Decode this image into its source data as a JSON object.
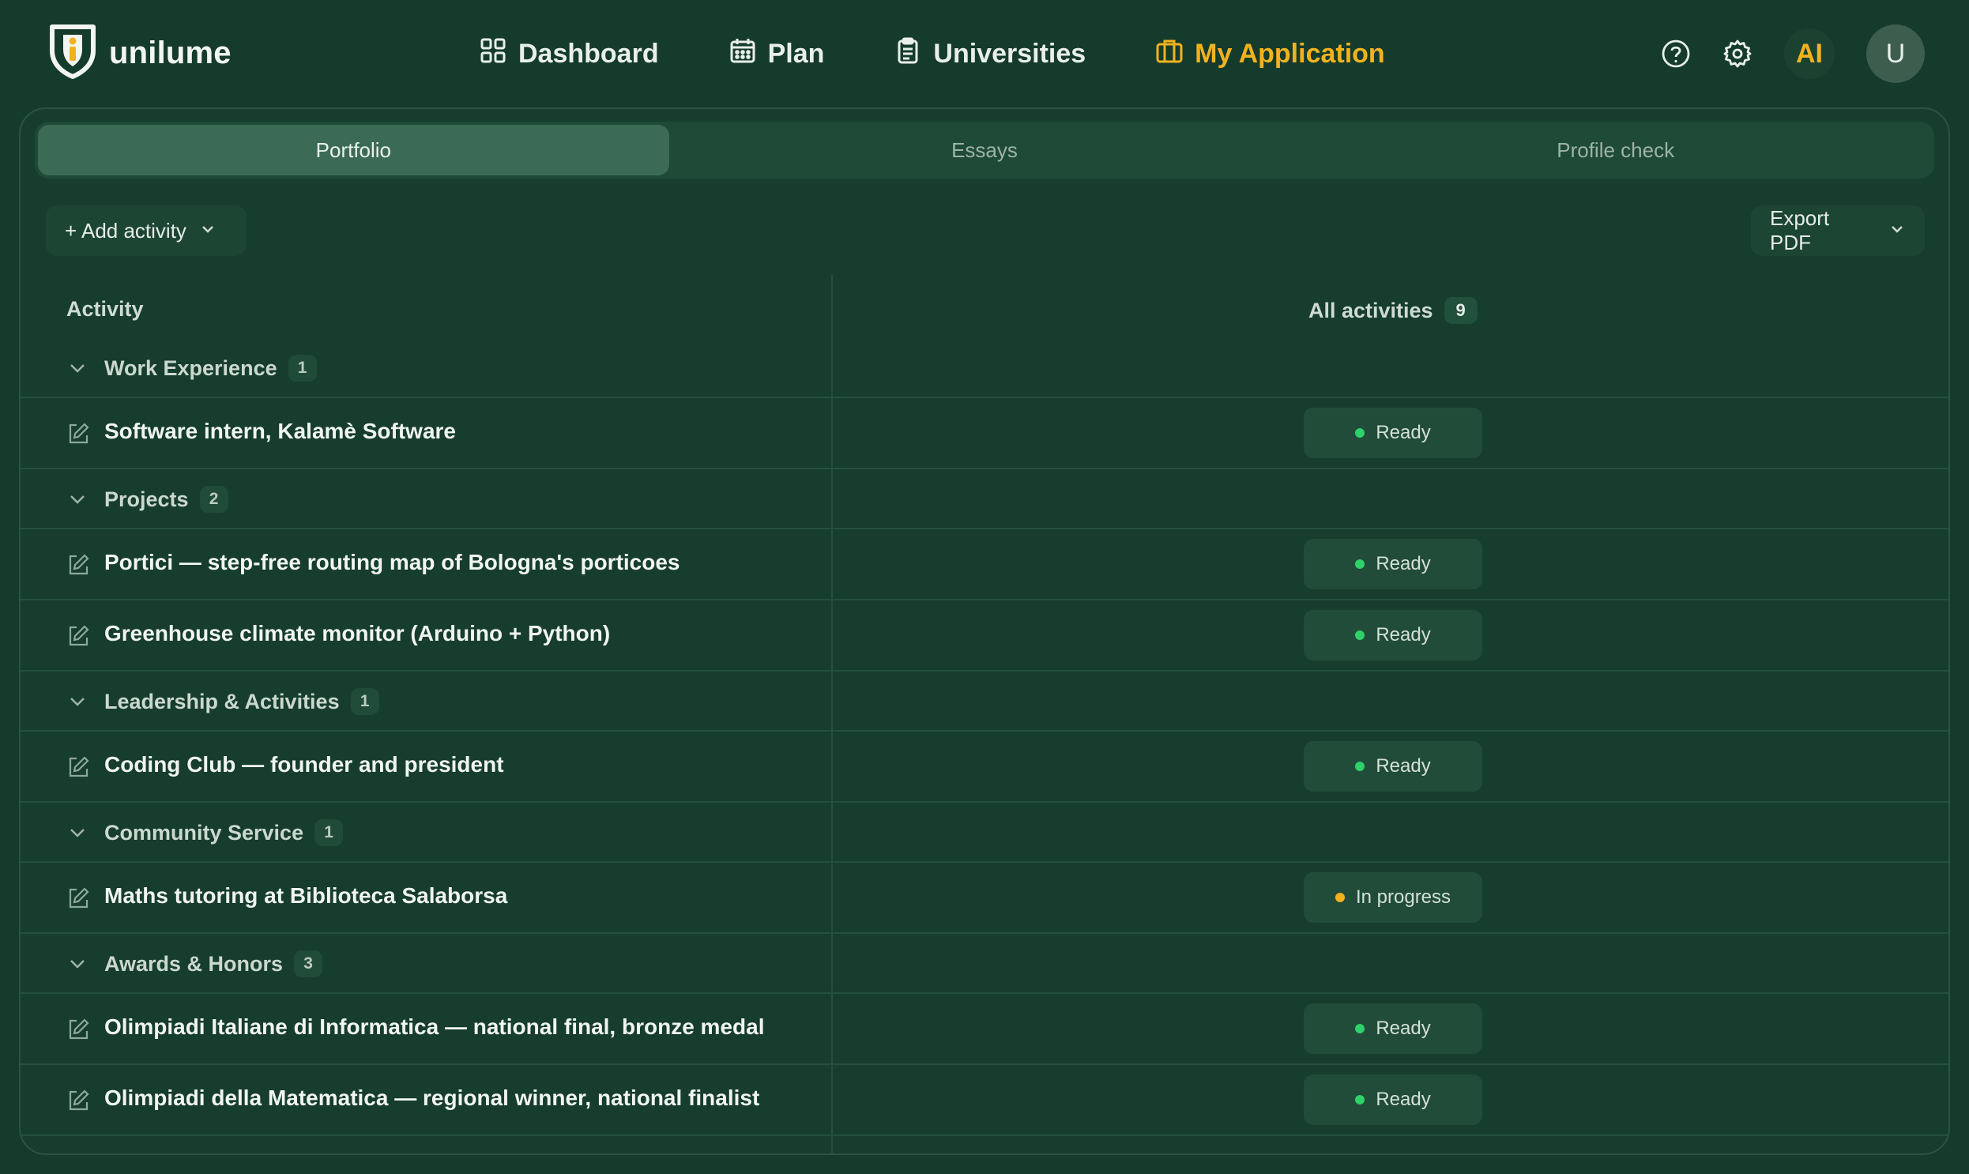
{
  "app": {
    "brand": "unilume"
  },
  "nav": [
    {
      "label": "Dashboard",
      "icon": "grid-icon",
      "active": false
    },
    {
      "label": "Plan",
      "icon": "calendar-icon",
      "active": false
    },
    {
      "label": "Universities",
      "icon": "clipboard-icon",
      "active": false
    },
    {
      "label": "My Application",
      "icon": "briefcase-icon",
      "active": true
    }
  ],
  "tools": {
    "ai_label": "AI",
    "avatar_initial": "U"
  },
  "tabs": [
    {
      "label": "Portfolio",
      "active": true
    },
    {
      "label": "Essays",
      "active": false
    },
    {
      "label": "Profile check",
      "active": false
    }
  ],
  "toolbar": {
    "add_label": "+ Add activity",
    "export_label": "Export PDF"
  },
  "table": {
    "col_activity": "Activity",
    "col_all": "All activities",
    "all_count": "9",
    "groups": [
      {
        "name": "Work Experience",
        "count": "1",
        "items": [
          {
            "title": "Software intern, Kalamè Software",
            "status": "Ready"
          }
        ]
      },
      {
        "name": "Projects",
        "count": "2",
        "items": [
          {
            "title": "Portici — step-free routing map of Bologna's porticoes",
            "status": "Ready"
          },
          {
            "title": "Greenhouse climate monitor (Arduino + Python)",
            "status": "Ready"
          }
        ]
      },
      {
        "name": "Leadership & Activities",
        "count": "1",
        "items": [
          {
            "title": "Coding Club — founder and president",
            "status": "Ready"
          }
        ]
      },
      {
        "name": "Community Service",
        "count": "1",
        "items": [
          {
            "title": "Maths tutoring at Biblioteca Salaborsa",
            "status": "In progress"
          }
        ]
      },
      {
        "name": "Awards & Honors",
        "count": "3",
        "items": [
          {
            "title": "Olimpiadi Italiane di Informatica — national final, bronze medal",
            "status": "Ready"
          },
          {
            "title": "Olimpiadi della Matematica — regional winner, national finalist",
            "status": "Ready"
          }
        ]
      }
    ]
  },
  "colors": {
    "background": "#153b2c",
    "accent": "#f2b21f",
    "ready": "#2fd16b",
    "in_progress": "#f2b21f"
  }
}
